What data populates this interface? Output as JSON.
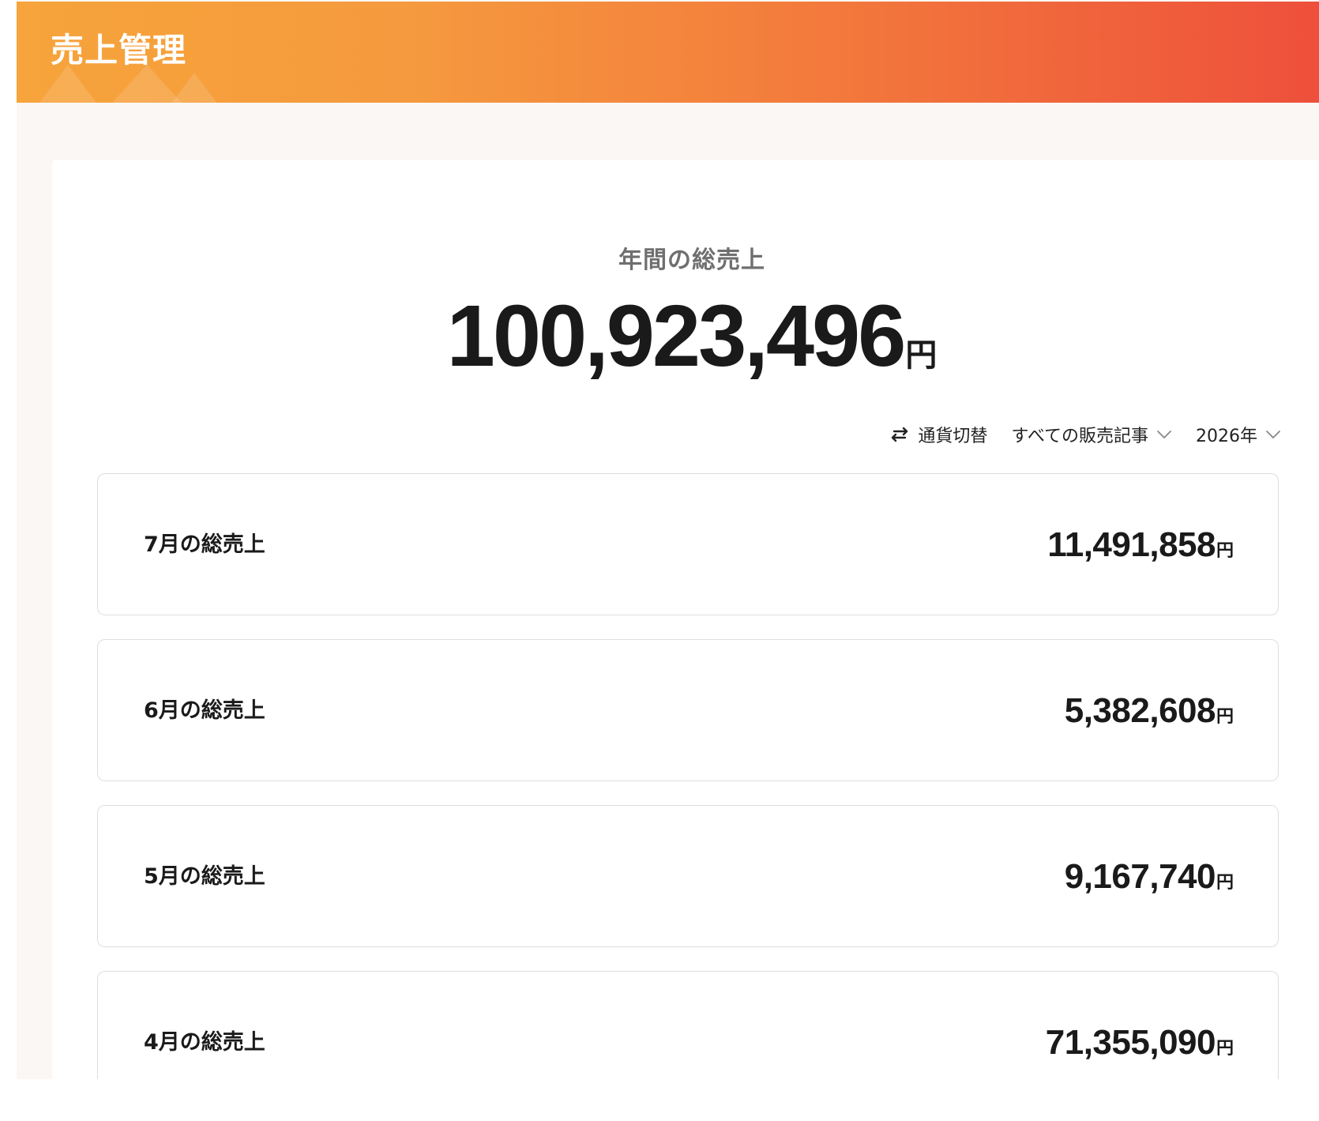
{
  "header": {
    "title": "売上管理"
  },
  "summary": {
    "label": "年間の総売上",
    "total": "100,923,496",
    "unit": "円"
  },
  "controls": {
    "currency_switch": "通貨切替",
    "article_filter": "すべての販売記事",
    "year_filter": "2026年"
  },
  "months": [
    {
      "label": "7月の総売上",
      "value": "11,491,858",
      "unit": "円"
    },
    {
      "label": "6月の総売上",
      "value": "5,382,608",
      "unit": "円"
    },
    {
      "label": "5月の総売上",
      "value": "9,167,740",
      "unit": "円"
    },
    {
      "label": "4月の総売上",
      "value": "71,355,090",
      "unit": "円"
    }
  ],
  "colors": {
    "header_start": "#f6a43b",
    "header_end": "#ee503b",
    "background": "#faf7f4",
    "card": "#ffffff"
  }
}
